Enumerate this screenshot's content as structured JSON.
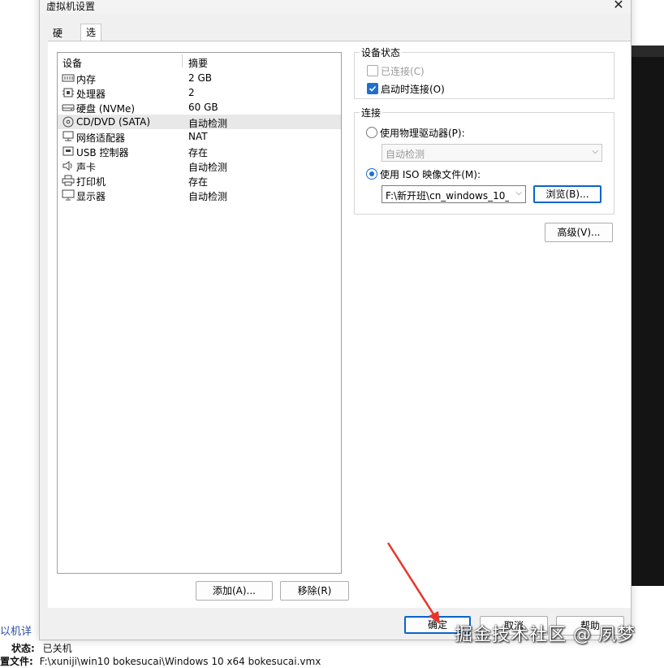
{
  "window": {
    "title": "虚拟机设置"
  },
  "tabs": [
    {
      "label": "硬件"
    },
    {
      "label": "选项"
    }
  ],
  "device_list": {
    "headers": {
      "device": "设备",
      "summary": "摘要"
    },
    "rows": [
      {
        "name": "内存",
        "summary": "2 GB",
        "icon": "memory-icon"
      },
      {
        "name": "处理器",
        "summary": "2",
        "icon": "cpu-icon"
      },
      {
        "name": "硬盘 (NVMe)",
        "summary": "60 GB",
        "icon": "harddisk-icon"
      },
      {
        "name": "CD/DVD (SATA)",
        "summary": "自动检测",
        "icon": "cd-icon",
        "selected": true
      },
      {
        "name": "网络适配器",
        "summary": "NAT",
        "icon": "network-icon"
      },
      {
        "name": "USB 控制器",
        "summary": "存在",
        "icon": "usb-icon"
      },
      {
        "name": "声卡",
        "summary": "自动检测",
        "icon": "speaker-icon"
      },
      {
        "name": "打印机",
        "summary": "存在",
        "icon": "printer-icon"
      },
      {
        "name": "显示器",
        "summary": "自动检测",
        "icon": "monitor-icon"
      }
    ],
    "add_label": "添加(A)...",
    "remove_label": "移除(R)"
  },
  "device_status": {
    "title": "设备状态",
    "connected_label": "已连接(C)",
    "connected_checked": false,
    "connect_on_power_label": "启动时连接(O)",
    "connect_on_power_checked": true
  },
  "connection": {
    "title": "连接",
    "physical_label": "使用物理驱动器(P):",
    "physical_value": "自动检测",
    "iso_label": "使用 ISO 映像文件(M):",
    "iso_value": "F:\\新开班\\cn_windows_10_",
    "browse_label": "浏览(B)...",
    "selected": "iso"
  },
  "advanced_label": "高级(V)...",
  "footer": {
    "ok": "确定",
    "cancel": "取消",
    "help": "帮助"
  },
  "background": {
    "details_title": "以机详",
    "status_label": "状态:",
    "status_value": "已关机",
    "config_label": "置文件:",
    "config_value": "F:\\xuniji\\win10 bokesucai\\Windows 10 x64 bokesucai.vmx"
  },
  "watermark": "掘金技术社区 @ 夙梦",
  "colors": {
    "accent": "#1f6fcf",
    "arrow": "#e8352a"
  }
}
